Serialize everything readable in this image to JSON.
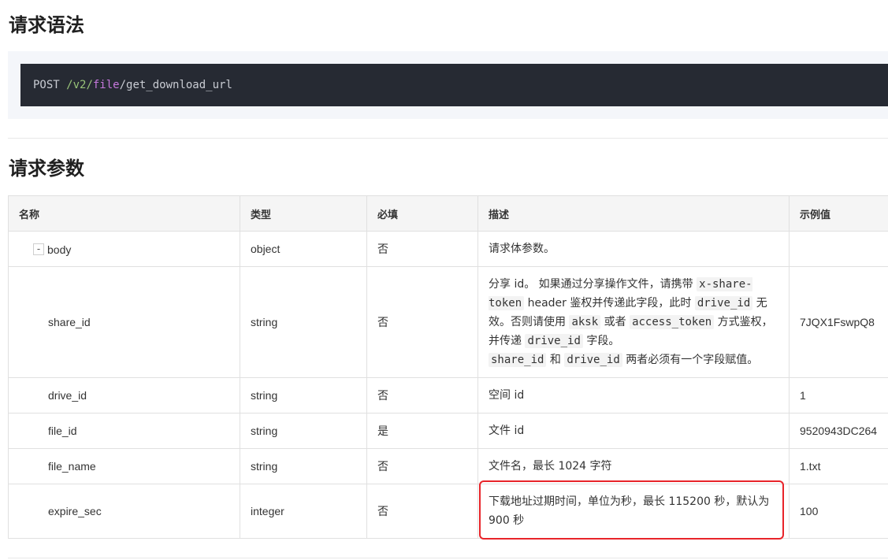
{
  "sections": {
    "syntax_title": "请求语法",
    "params_title": "请求参数"
  },
  "code": {
    "method": "POST",
    "seg1": "/v2/",
    "seg2": "file",
    "seg3": "/get_download_url"
  },
  "table": {
    "headers": [
      "名称",
      "类型",
      "必填",
      "描述",
      "示例值"
    ],
    "collapse_symbol": "-",
    "rows": [
      {
        "name": "body",
        "type": "object",
        "required": "否",
        "desc": "请求体参数。",
        "example": ""
      },
      {
        "name": "share_id",
        "type": "string",
        "required": "否",
        "desc_parts": [
          "分享 id。 如果通过分享操作文件，请携带 ",
          "x-share-token",
          " header 鉴权并传递此字段，此时 ",
          "drive_id",
          " 无效。否则请使用 ",
          "aksk",
          " 或者 ",
          "access_token",
          " 方式鉴权，并传递 ",
          "drive_id",
          " 字段。",
          "share_id",
          " 和 ",
          "drive_id",
          " 两者必须有一个字段赋值。"
        ],
        "example": "7JQX1FswpQ8"
      },
      {
        "name": "drive_id",
        "type": "string",
        "required": "否",
        "desc": "空间 id",
        "example": "1"
      },
      {
        "name": "file_id",
        "type": "string",
        "required": "是",
        "desc": "文件 id",
        "example": "9520943DC264"
      },
      {
        "name": "file_name",
        "type": "string",
        "required": "否",
        "desc": "文件名，最长 1024 字符",
        "example": "1.txt"
      },
      {
        "name": "expire_sec",
        "type": "integer",
        "required": "否",
        "desc": "下载地址过期时间，单位为秒，最长 115200 秒，默认为 900 秒",
        "example": "100"
      }
    ]
  },
  "colors": {
    "highlight": "#e8242a",
    "code_bg": "#262a33",
    "path": "#98c379",
    "keyword": "#c678dd"
  }
}
